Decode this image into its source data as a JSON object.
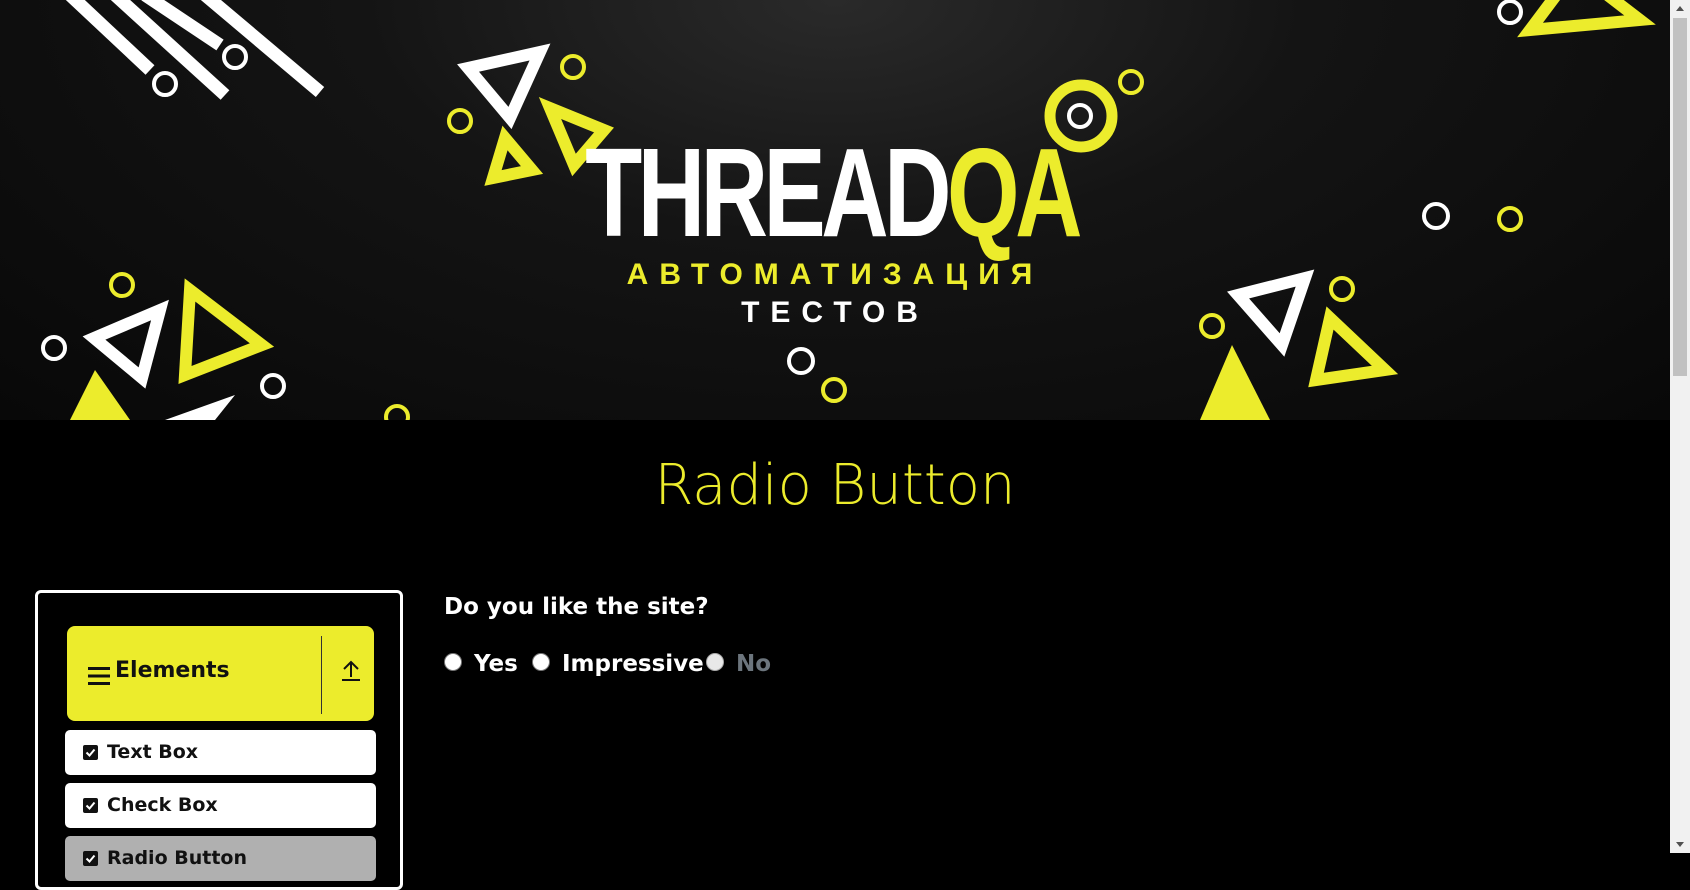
{
  "banner": {
    "logo_title_white": "THREAD",
    "logo_title_yellow": "QA",
    "logo_subtitle_line1": "АВТОМАТИЗАЦИЯ",
    "logo_subtitle_line2": "ТЕСТОВ"
  },
  "page": {
    "title": "Radio Button"
  },
  "sidebar": {
    "group_label": "Elements",
    "items": [
      {
        "label": "Text Box"
      },
      {
        "label": "Check Box"
      },
      {
        "label": "Radio Button"
      }
    ]
  },
  "main": {
    "question": "Do you like the site?",
    "options": [
      {
        "label": "Yes",
        "enabled": true,
        "checked": false
      },
      {
        "label": "Impressive",
        "enabled": true,
        "checked": false
      },
      {
        "label": "No",
        "enabled": false,
        "checked": false
      }
    ]
  },
  "colors": {
    "accent_yellow": "#ecec2c",
    "background": "#000000",
    "disabled_text": "#6c757d"
  },
  "icons": {
    "menu": "hamburger-icon",
    "collapse": "collapse-up-icon",
    "item": "checkbox-icon"
  }
}
